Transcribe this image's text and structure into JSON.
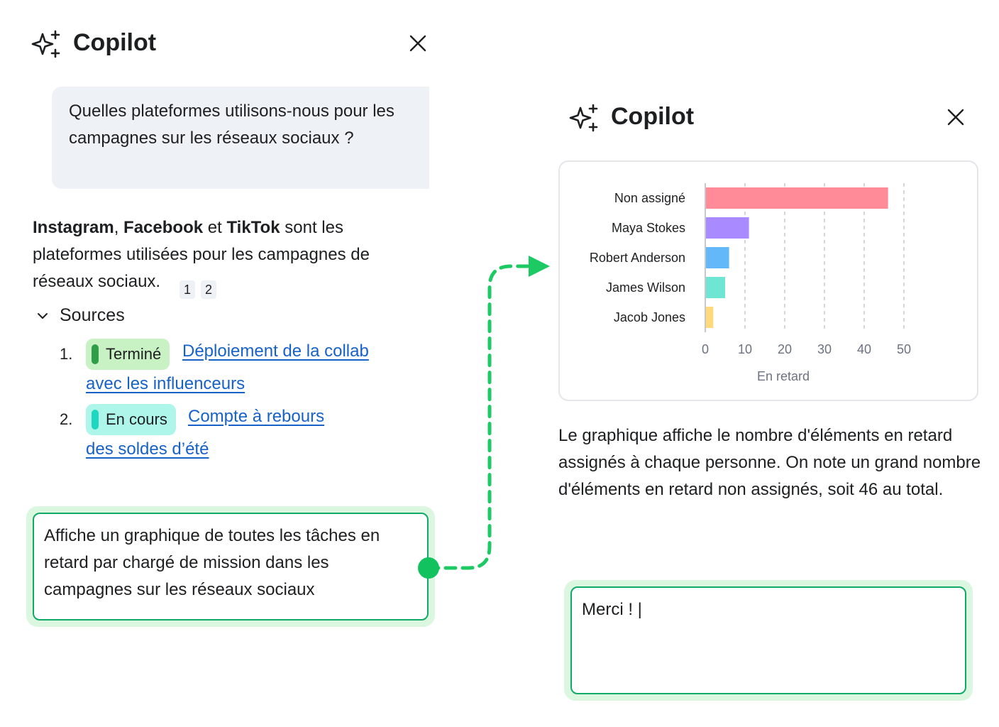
{
  "left_panel": {
    "title": "Copilot",
    "user_message": "Quelles plateformes utilisons-nous pour les campagnes sur les réseaux sociaux ?",
    "answer": {
      "p1": "Instagram",
      "sep1": ", ",
      "p2": "Facebook",
      "sep2": " et ",
      "p3": "TikTok",
      "rest": " sont les plateformes utilisées pour les campagnes de réseaux sociaux.",
      "citations": [
        "1",
        "2"
      ]
    },
    "sources_label": "Sources",
    "sources": [
      {
        "num": "1.",
        "status": "Terminé",
        "status_color": "#2e9e4a",
        "status_bg": "#c9f2c4",
        "title_line1": "Déploiement de la collab",
        "title_line2": "avec les influenceurs"
      },
      {
        "num": "2.",
        "status": "En cours",
        "status_color": "#1dd8bf",
        "status_bg": "#aef5ea",
        "title_line1": "Compte à rebours",
        "title_line2": "des soldes d’été"
      }
    ],
    "prompt": "Affiche un graphique de toutes les tâches en retard par chargé de mission dans les campagnes sur les réseaux sociaux"
  },
  "right_panel": {
    "title": "Copilot",
    "description": "Le graphique affiche le nombre d'éléments en retard assignés à chaque personne. On note un grand nombre d'éléments en retard non assignés, soit 46 au total.",
    "input_value": "Merci ! |"
  },
  "chart_data": {
    "type": "bar",
    "orientation": "horizontal",
    "categories": [
      "Non assigné",
      "Maya Stokes",
      "Robert Anderson",
      "James Wilson",
      "Jacob Jones"
    ],
    "values": [
      46,
      11,
      6,
      5,
      2
    ],
    "colors": [
      "#ff8a98",
      "#a98bff",
      "#62b8f9",
      "#6ee6d3",
      "#ffd97a"
    ],
    "xticks": [
      "0",
      "10",
      "20",
      "30",
      "40",
      "50"
    ],
    "xlim": [
      0,
      50
    ],
    "xlabel": "En retard",
    "grid": "vertical dashed"
  },
  "colors": {
    "accent_green": "#11a968",
    "connector": "#1dc962",
    "link": "#1762c8"
  }
}
